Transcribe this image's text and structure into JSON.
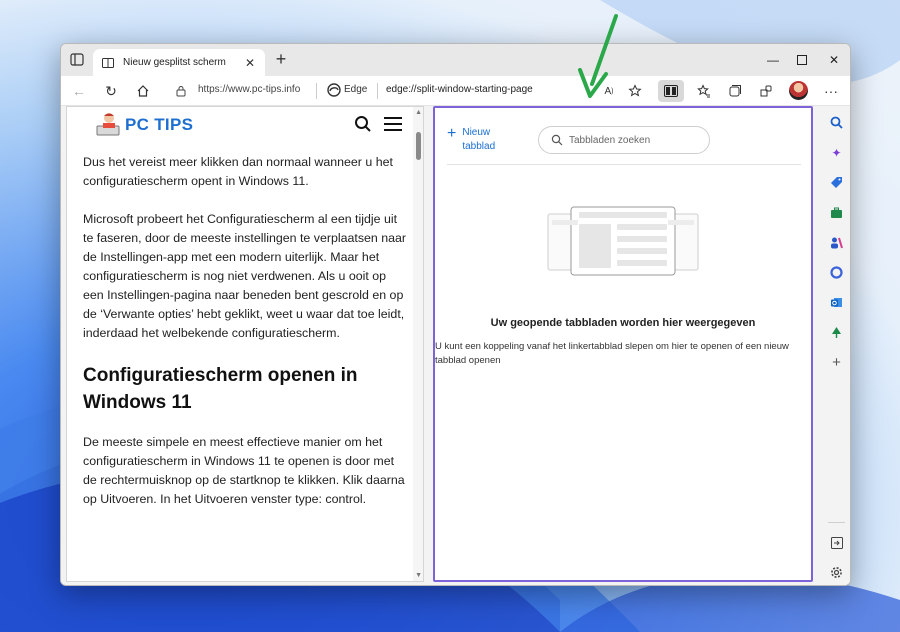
{
  "browser": {
    "tab_title": "Nieuw gesplitst scherm",
    "url": "https://www.pc-tips.info",
    "browser_name": "Edge",
    "page_url": "edge://split-window-starting-page"
  },
  "site": {
    "logo_text": "PC TIPS"
  },
  "article": {
    "para1": "Dus het vereist meer klikken dan normaal wanneer u het configuratiescherm opent in Windows 11.",
    "para2": "Microsoft probeert het Configuratiescherm al een tijdje uit te faseren, door de meeste instellingen te verplaatsen naar de Instellingen-app met een modern uiterlijk. Maar het configuratiescherm is nog niet verdwenen. Als u ooit op een Instellingen-pagina naar beneden bent gescrold en op de ‘Verwante opties’ hebt geklikt, weet u waar dat toe leidt, inderdaad het welbekende configuratiescherm.",
    "heading": "Configuratiescherm openen in Windows 11",
    "para3": "De meeste simpele en meest effectieve manier om het configuratiescherm in Windows 11 te openen is door met de rechtermuisknop op de startknop te klikken. Klik daarna op Uitvoeren. In het Uitvoeren venster type: control."
  },
  "split": {
    "new_tab_line1": "Nieuw",
    "new_tab_line2": "tabblad",
    "search_placeholder": "Tabbladen zoeken",
    "empty_title": "Uw geopende tabbladen worden hier weergegeven",
    "empty_desc": "U kunt een koppeling vanaf het linkertabblad slepen om hier te openen of een nieuw tabblad openen"
  },
  "colors": {
    "accent": "#7c64d8",
    "link": "#1a6fd6",
    "logo_blue": "#1f6fd1",
    "arrow": "#2aa84a"
  }
}
